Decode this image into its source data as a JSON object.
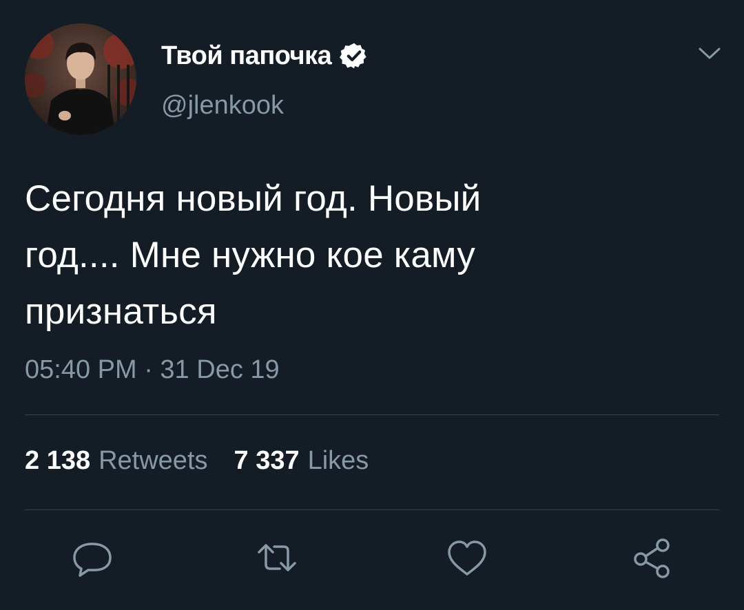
{
  "tweet": {
    "display_name": "Твой папочка",
    "handle": "@jlenkook",
    "verified": true,
    "text_lines": [
      "Сегодня новый год. Новый",
      "год.... Мне нужно кое каму",
      "признаться"
    ],
    "timestamp": "05:40 PM · 31 Dec 19"
  },
  "stats": {
    "retweets_count": "2 138",
    "retweets_label": "Retweets",
    "likes_count": "7 337",
    "likes_label": "Likes"
  },
  "icons": {
    "verified": "verified-badge-icon",
    "menu": "chevron-down-icon",
    "reply": "reply-icon",
    "retweet": "retweet-icon",
    "like": "heart-icon",
    "share": "share-icon"
  },
  "colors": {
    "background": "#141d26",
    "primary_text": "#ffffff",
    "secondary_text": "#8899a6",
    "divider": "#38444d"
  }
}
